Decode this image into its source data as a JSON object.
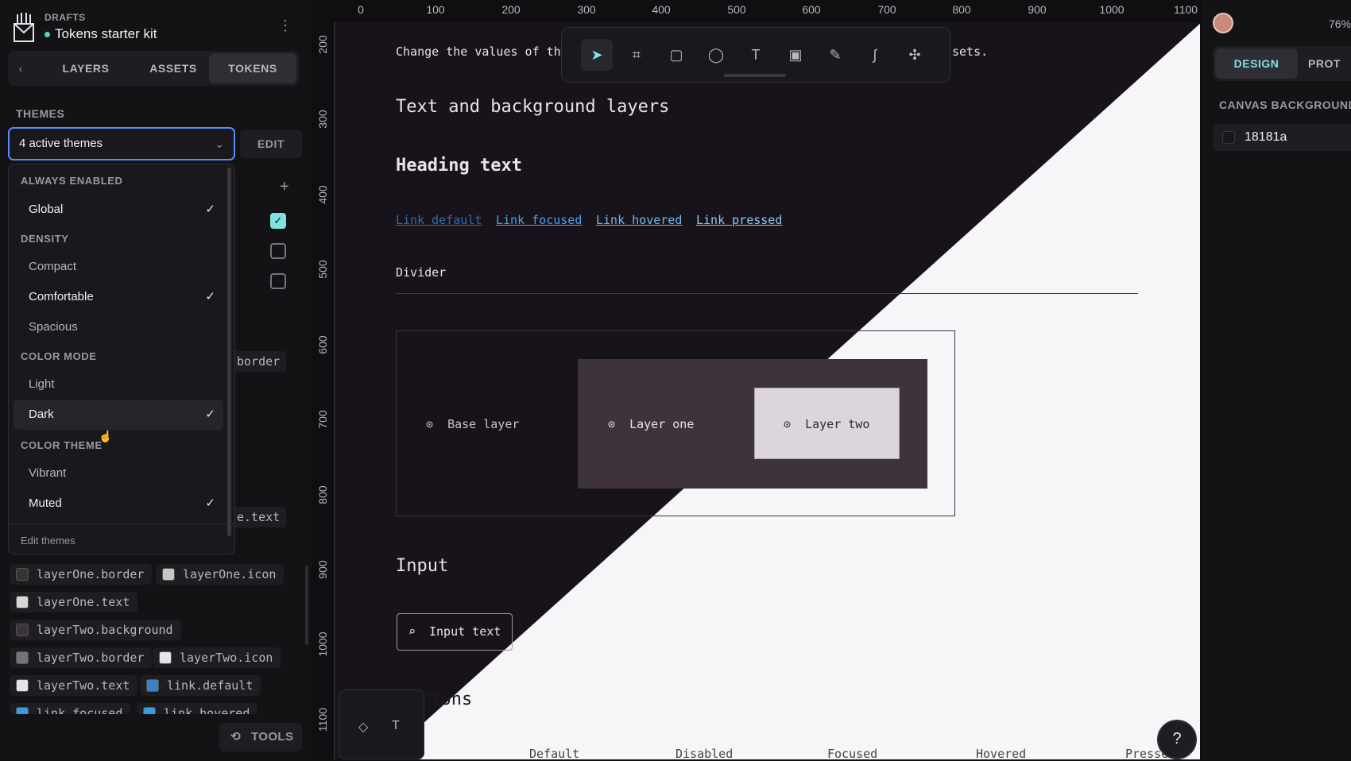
{
  "app": {
    "drafts_label": "DRAFTS",
    "project_name": "Tokens starter kit"
  },
  "left_tabs": {
    "layers": "LAYERS",
    "assets": "ASSETS",
    "tokens": "TOKENS"
  },
  "themes": {
    "label": "THEMES",
    "selected": "4 active themes",
    "edit_label": "EDIT"
  },
  "dropdown": {
    "groups": [
      {
        "label": "ALWAYS ENABLED",
        "items": [
          {
            "label": "Global",
            "checked": true
          }
        ]
      },
      {
        "label": "DENSITY",
        "items": [
          {
            "label": "Compact",
            "checked": false
          },
          {
            "label": "Comfortable",
            "checked": true
          },
          {
            "label": "Spacious",
            "checked": false
          }
        ]
      },
      {
        "label": "COLOR MODE",
        "items": [
          {
            "label": "Light",
            "checked": false
          },
          {
            "label": "Dark",
            "checked": true
          }
        ]
      },
      {
        "label": "COLOR THEME",
        "items": [
          {
            "label": "Vibrant",
            "checked": false
          },
          {
            "label": "Muted",
            "checked": true
          }
        ]
      }
    ],
    "footer": "Edit themes"
  },
  "background_tokens": {
    "partial1": "border",
    "partial2": "e.text"
  },
  "tokens": [
    {
      "name": "layerOne.border",
      "color": "#3a3236"
    },
    {
      "name": "layerOne.icon",
      "color": "#c9c4c8"
    },
    {
      "name": "layerOne.text",
      "color": "#d9d6d8"
    },
    {
      "name": "layerTwo.background",
      "color": "#3e323c"
    },
    {
      "name": "layerTwo.border",
      "color": "#76717a"
    },
    {
      "name": "layerTwo.icon",
      "color": "#e6e4e8"
    },
    {
      "name": "layerTwo.text",
      "color": "#e6e4e8"
    },
    {
      "name": "link.default",
      "color": "#3b82c4"
    },
    {
      "name": "link.focused",
      "color": "#3b9ae0"
    },
    {
      "name": "link.hovered",
      "color": "#3b9ae0"
    }
  ],
  "tools_label": "TOOLS",
  "ruler": {
    "h": [
      "0",
      "100",
      "200",
      "300",
      "400",
      "500",
      "600",
      "700",
      "800",
      "900",
      "1000",
      "1100"
    ],
    "v": [
      "200",
      "300",
      "400",
      "500",
      "600",
      "700",
      "800",
      "900",
      "1000",
      "1100"
    ]
  },
  "canvas": {
    "intro_left": "Change the values of th",
    "intro_right": "sets.",
    "section_text": "Text and background layers",
    "heading": "Heading text",
    "links": [
      "Link default",
      "Link focused",
      "Link hovered",
      "Link pressed"
    ],
    "divider_label": "Divider",
    "base_layer": "Base layer",
    "layer_one": "Layer one",
    "layer_two": "Layer two",
    "input_title": "Input",
    "input_placeholder": "Input text",
    "buttons_title": "ttons",
    "button_columns": [
      "Default",
      "Disabled",
      "Focused",
      "Hovered",
      "Presse"
    ]
  },
  "right_panel": {
    "zoom": "76%",
    "tab_design": "DESIGN",
    "tab_prototype": "PROT",
    "canvas_bg_label": "CANVAS BACKGROUND",
    "canvas_bg_value": "18181a"
  },
  "colors": {
    "accent": "#5a8bff",
    "teal": "#7fe3e0",
    "canvas_dark": "#18131a",
    "canvas_light": "#f6f5f8"
  }
}
